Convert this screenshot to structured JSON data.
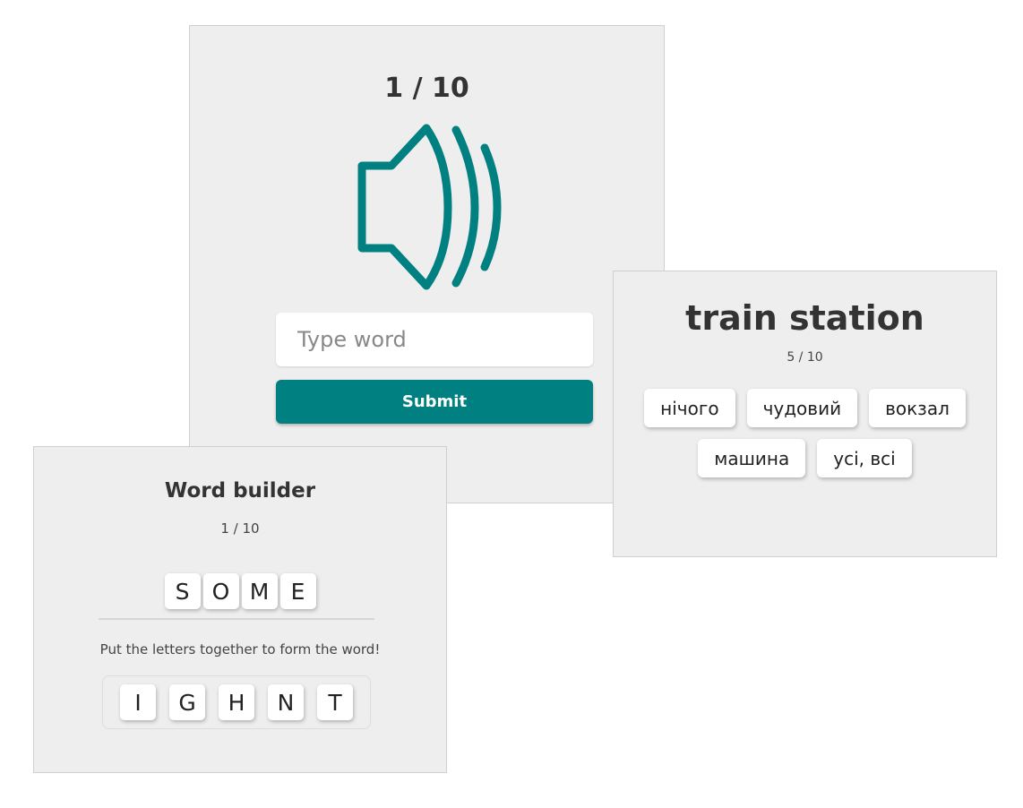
{
  "colors": {
    "accent": "#008080",
    "card_bg": "#eeeeee"
  },
  "listening": {
    "counter": "1 / 10",
    "icon": "speaker-icon",
    "input_placeholder": "Type word",
    "input_value": "",
    "submit_label": "Submit"
  },
  "builder": {
    "title": "Word builder",
    "counter": "1 / 10",
    "answer_letters": [
      "S",
      "O",
      "M",
      "E"
    ],
    "instruction": "Put the letters together to form the word!",
    "available_letters": [
      "I",
      "G",
      "H",
      "N",
      "T"
    ]
  },
  "translate": {
    "word": "train station",
    "counter": "5 / 10",
    "options": [
      "нічого",
      "чудовий",
      "вокзал",
      "машина",
      "усі, всі"
    ]
  }
}
